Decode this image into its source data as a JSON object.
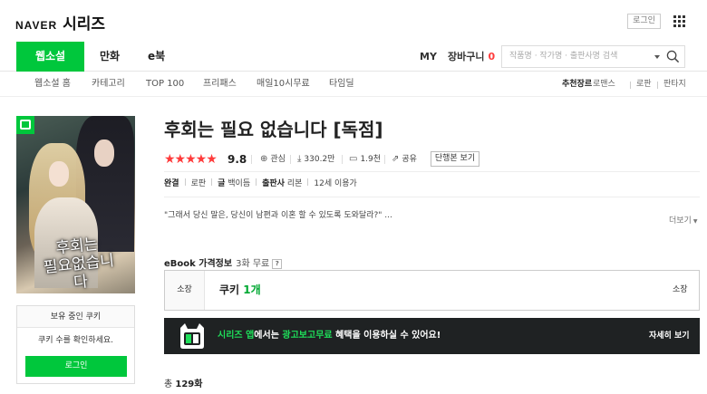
{
  "header": {
    "brand": "NAVER",
    "service": "시리즈",
    "login_label": "로그인"
  },
  "nav": {
    "tabs": [
      {
        "label": "웹소설",
        "active": true
      },
      {
        "label": "만화",
        "active": false
      },
      {
        "label": "e북",
        "active": false
      }
    ],
    "my_label": "MY",
    "cart_label": "장바구니",
    "cart_count": "0",
    "search_placeholder": "작품명 · 작가명 · 출판사명 검색"
  },
  "subnav": {
    "items": [
      "웹소설 홈",
      "카테고리",
      "TOP 100",
      "프리패스",
      "매일10시무료",
      "타임딜"
    ],
    "genre_label": "추천장르",
    "genres": [
      "로맨스",
      "로판",
      "판타지"
    ]
  },
  "book": {
    "cover_title": "후회는\n필요없습니다",
    "title": "후회는 필요 없습니다 [독점]",
    "stars": "★★★★★",
    "rating": "9.8",
    "interest_label": "관심",
    "downloads": "330.2만",
    "comments": "1.9천",
    "share_label": "공유",
    "hardcopy_label": "단행본 보기",
    "status": "완결",
    "genre": "로판",
    "author_label": "글",
    "author": "백이듬",
    "publisher_label": "출판사",
    "publisher": "리본",
    "age": "12세 이용가",
    "synopsis": "\"그래서 당신 말은, 당신이 남편과 이혼 할 수 있도록 도와달라?\" ...",
    "more_label": "더보기"
  },
  "owned": {
    "title": "보유 중인 쿠키",
    "message": "쿠키 수를 확인하세요.",
    "login_label": "로그인"
  },
  "price": {
    "title": "eBook 가격정보",
    "free_info": "3화 무료",
    "help": "?",
    "row_label": "소장",
    "cookie_label": "쿠키",
    "cookie_count": "1개",
    "buy_label": "소장"
  },
  "banner": {
    "app_name": "시리즈 앱",
    "text_mid": "에서는 ",
    "highlight": "광고보고무료",
    "text_end": " 혜택을 이용하실 수 있어요!",
    "detail_label": "자세히 보기"
  },
  "episodes": {
    "prefix": "총",
    "count": "129화"
  },
  "colors": {
    "brand_green": "#00c73c",
    "star_red": "#ff3b3b",
    "banner_bg": "#1f2223"
  }
}
